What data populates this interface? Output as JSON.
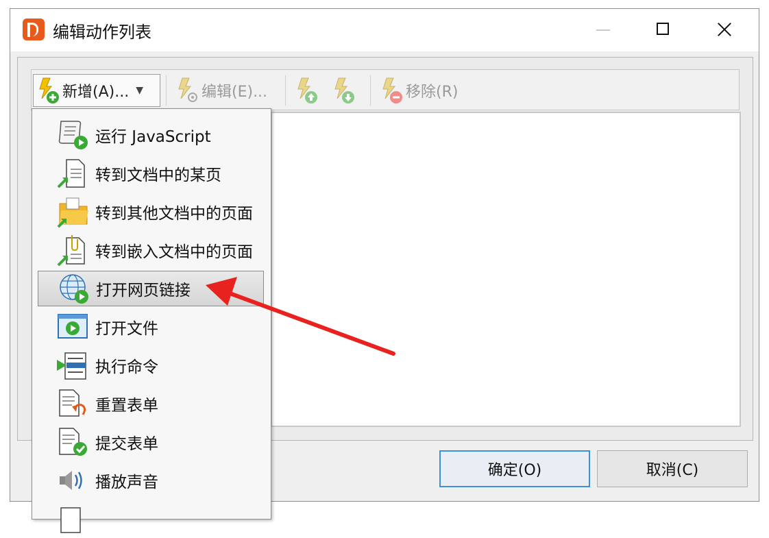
{
  "window": {
    "title": "编辑动作列表",
    "controls": {
      "minimize": "minimize-icon",
      "maximize": "maximize-icon",
      "close": "close-icon"
    }
  },
  "toolbar": {
    "new_label": "新增(A)...",
    "edit_label": "编辑(E)...",
    "remove_label": "移除(R)"
  },
  "menu": {
    "items": [
      {
        "label": "运行 JavaScript",
        "icon": "script-run-icon"
      },
      {
        "label": "转到文档中的某页",
        "icon": "goto-page-icon"
      },
      {
        "label": "转到其他文档中的页面",
        "icon": "goto-other-doc-icon"
      },
      {
        "label": "转到嵌入文档中的页面",
        "icon": "goto-embedded-doc-icon"
      },
      {
        "label": "打开网页链接",
        "icon": "web-link-icon",
        "highlighted": true
      },
      {
        "label": "打开文件",
        "icon": "open-file-icon"
      },
      {
        "label": "执行命令",
        "icon": "execute-command-icon"
      },
      {
        "label": "重置表单",
        "icon": "reset-form-icon"
      },
      {
        "label": "提交表单",
        "icon": "submit-form-icon"
      },
      {
        "label": "播放声音",
        "icon": "play-sound-icon"
      }
    ]
  },
  "buttons": {
    "ok_label": "确定(O)",
    "cancel_label": "取消(C)"
  },
  "colors": {
    "accent_red": "#e8221f",
    "bolt_yellow": "#f2c200",
    "play_green": "#3aa935",
    "ok_border": "#3c8fd9"
  }
}
